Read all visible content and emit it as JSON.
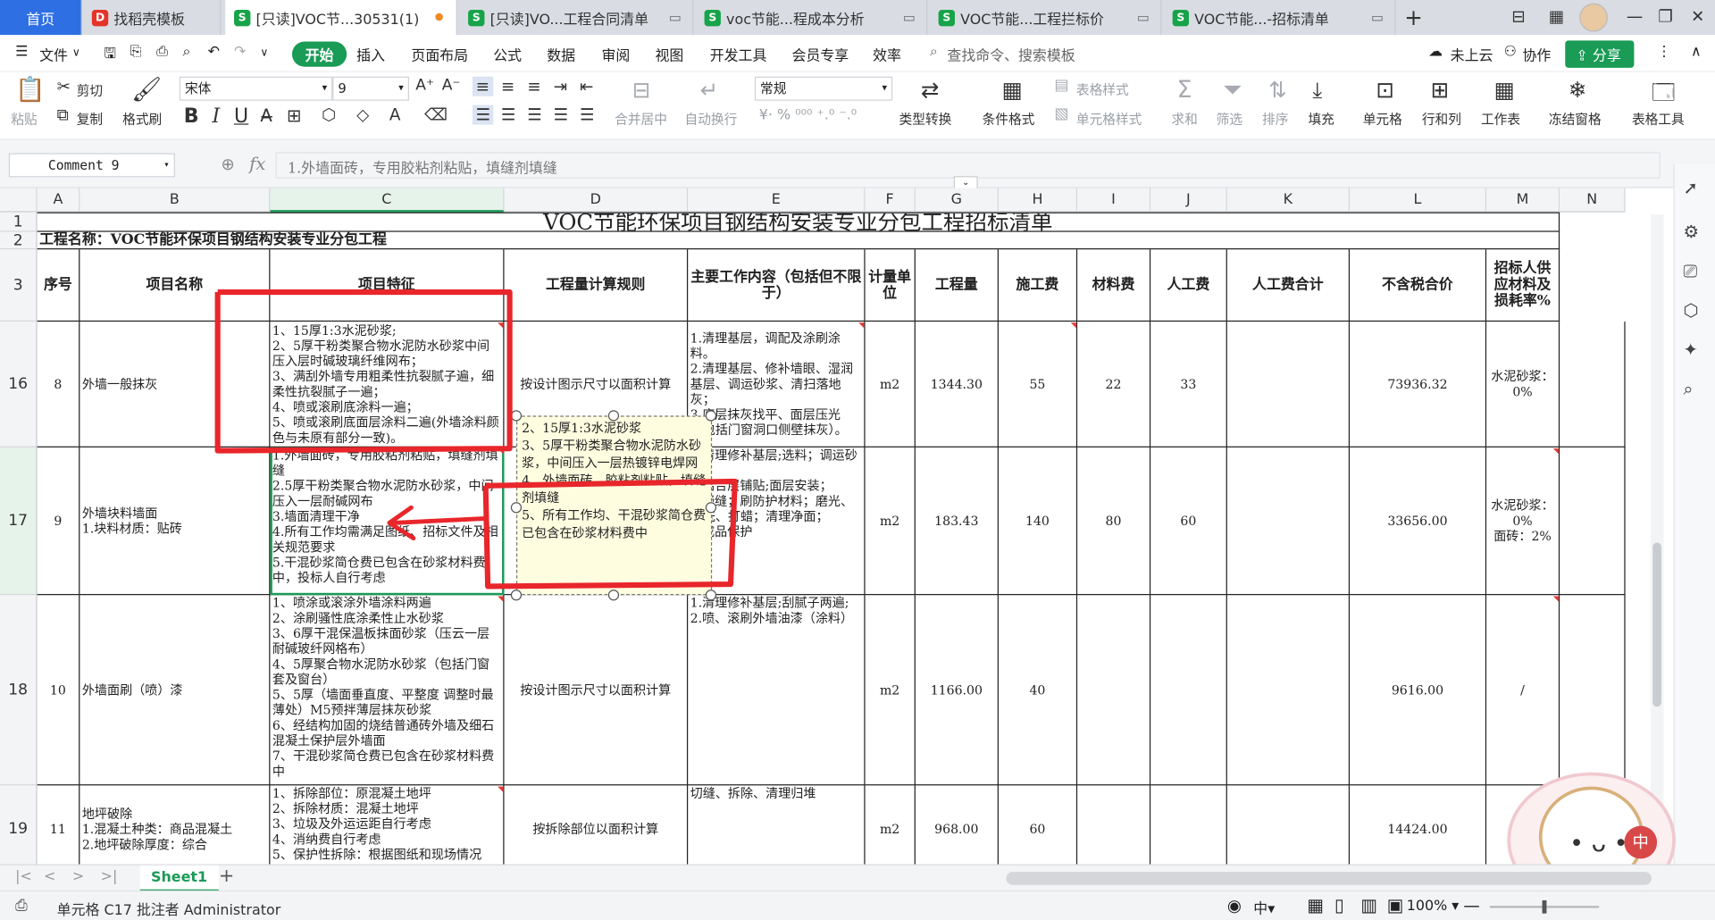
{
  "tabs": {
    "home": "首页",
    "items": [
      {
        "label": "找稻壳模板"
      },
      {
        "label": "[只读]VOC节...30531(1)"
      },
      {
        "label": "[只读]VO...工程合同清单"
      },
      {
        "label": "voc节能...程成本分析"
      },
      {
        "label": "VOC节能...工程拦标价"
      },
      {
        "label": "VOC节能...-招标清单"
      }
    ],
    "add": "+"
  },
  "menu": {
    "file": "文件",
    "items": [
      "开始",
      "插入",
      "页面布局",
      "公式",
      "数据",
      "审阅",
      "视图",
      "开发工具",
      "会员专享",
      "效率"
    ],
    "search": "查找命令、搜索模板",
    "cloud": "未上云",
    "collab": "协作",
    "share": "分享"
  },
  "ribbon": {
    "paste": "粘贴",
    "cut": "剪切",
    "copy": "复制",
    "format_painter": "格式刷",
    "font_name": "宋体",
    "font_size": "9",
    "merge": "合并居中",
    "wrap": "自动换行",
    "number_format": "常规",
    "convert": "类型转换",
    "cond_format": "条件格式",
    "table_style": "表格样式",
    "cell_style": "单元格样式",
    "sum": "求和",
    "filter": "筛选",
    "sort": "排序",
    "fill": "填充",
    "cell": "单元格",
    "rowcol": "行和列",
    "sheet": "工作表",
    "freeze": "冻结窗格",
    "tools": "表格工具"
  },
  "formula_bar": {
    "name_box": "Comment 9",
    "fx": "fx",
    "content": "1.外墙面砖，专用胶粘剂粘贴，填缝剂填缝"
  },
  "columns": [
    "A",
    "B",
    "C",
    "D",
    "E",
    "F",
    "G",
    "H",
    "I",
    "J",
    "K",
    "L",
    "M",
    "N"
  ],
  "sheet": {
    "title": "VOC节能环保项目钢结构安装专业分包工程招标清单",
    "project_name": "工程名称：VOC节能环保项目钢结构安装专业分包工程",
    "headers": [
      "序号",
      "项目名称",
      "项目特征",
      "工程量计算规则",
      "主要工作内容（包括但不限于）",
      "计量单位",
      "工程量",
      "施工费",
      "材料费",
      "人工费",
      "人工费合计",
      "不含税合价",
      "招标人供应材料及损耗率%"
    ],
    "rows": [
      {
        "row": "16",
        "seq": "8",
        "name": "外墙一般抹灰",
        "features": "1、15厚1:3水泥砂浆;\n2、5厚干粉类聚合物水泥防水砂浆中间压入层时碱玻璃纤维网布；\n3、满刮外墙专用粗柔性抗裂腻子遍，细柔性抗裂腻子一遍；\n4、喷或滚刷底涂料一遍；\n5、喷或滚刷底面层涂料二遍(外墙涂料颜色与未原有部分一致)。",
        "rule": "按设计图示尺寸以面积计算",
        "work": "1.清理基层，调配及涂刷涂料。\n2.清理基层、修补墙眼、湿润基层、调运砂浆、清扫落地灰；\n3.底层抹灰找平、面层压光（包括门窗洞口侧壁抹灰）。",
        "unit": "m2",
        "qty": "1344.30",
        "labor_fee": "55",
        "material": "22",
        "labor": "33",
        "labor_total": "",
        "total": "73936.32",
        "supply": "水泥砂浆：\n0%"
      },
      {
        "row": "17",
        "seq": "9",
        "name": "外墙块料墙面\n1.块料材质：贴砖",
        "features": "1.外墙面砖，专用胶粘剂粘贴，填缝剂填缝\n2.5厚干粉类聚合物水泥防水砂浆，中间压入一层耐碱网布\n3.墙面清理干净\n4.所有工作均需满足图纸、招标文件及相关规范要求\n5.干混砂浆简仓费已包含在砂浆材料费中，投标人自行考虑",
        "rule": "",
        "work": "1.清理修补基层;选料；调运砂浆；\n2.结合层铺贴;面层安装；\n3.嵌缝；刷防护材料；磨光、酸洗、打蜡；清理净面；\n4.成品保护",
        "unit": "m2",
        "qty": "183.43",
        "labor_fee": "140",
        "material": "80",
        "labor": "60",
        "labor_total": "",
        "total": "33656.00",
        "supply": "水泥砂浆：\n0%\n面砖：2%"
      },
      {
        "row": "18",
        "seq": "10",
        "name": "外墙面刷（喷）漆",
        "features": "1、喷涂或滚涂外墙涂料两遍\n2、涂刷骚性底涂柔性止水砂浆\n3、6厚干混保温板抹面砂浆（压云一层耐碱玻纤网格布）\n4、5厚聚合物水泥防水砂浆（包括门窗套及窗台）\n5、5厚（墙面垂直度、平整度 调整时最薄处）M5预拌薄层抹灰砂浆\n6、经结构加固的烧结普通砖外墙及细石混凝土保护层外墙面\n7、干混砂浆简仓费已包含在砂浆材料费中",
        "rule": "按设计图示尺寸以面积计算",
        "work": "1.清理修补基层;刮腻子两遍;\n2.喷、滚刷外墙油漆（涂料）",
        "unit": "m2",
        "qty": "1166.00",
        "labor_fee": "40",
        "material": "",
        "labor": "",
        "labor_total": "",
        "total": "9616.00",
        "supply": "/"
      },
      {
        "row": "19",
        "seq": "11",
        "name": "地坪破除\n1.混凝土种类：商品混凝土\n2.地坪破除厚度：综合",
        "features": "1、拆除部位：原混凝土地坪\n2、拆除材质：混凝土地坪\n3、垃圾及外运运距自行考虑\n4、消纳费自行考虑\n5、保护性拆除：根据图纸和现场情况",
        "rule": "按拆除部位以面积计算",
        "work": "切缝、拆除、清理归堆",
        "unit": "m2",
        "qty": "968.00",
        "labor_fee": "60",
        "material": "",
        "labor": "",
        "labor_total": "",
        "total": "14424.00",
        "supply": ""
      }
    ]
  },
  "comment": {
    "text": "2、15厚1:3水泥砂浆\n3、5厚干粉类聚合物水泥防水砂浆，中间压入一层热镀锌电焊网\n4、外墙面砖，胶粘剂粘贴，填缝剂填缝\n5、所有工作均、干混砂浆简仓费已包含在砂浆材料费中"
  },
  "sheet_tabs": {
    "active": "Sheet1",
    "add": "+"
  },
  "status": {
    "cell_info": "单元格 C17 批注者 Administrator",
    "ime": "中",
    "zoom": "100%"
  },
  "colors": {
    "accent": "#1a9b56",
    "home_tab": "#2f6fe4",
    "annotation": "#e8262b"
  }
}
